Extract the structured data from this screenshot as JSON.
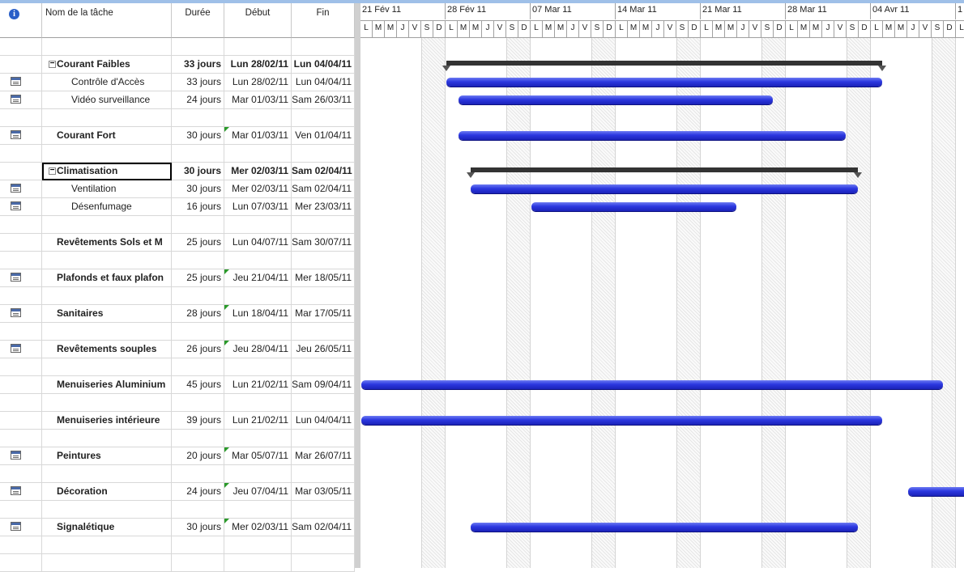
{
  "headers": {
    "name": "Nom de la tâche",
    "duree": "Durée",
    "debut": "Début",
    "fin": "Fin"
  },
  "timescale": {
    "weeks": [
      "21 Fév 11",
      "28 Fév 11",
      "07 Mar 11",
      "14 Mar 11",
      "21 Mar 11",
      "28 Mar 11",
      "04 Avr 11",
      "1"
    ],
    "days": [
      "L",
      "M",
      "M",
      "J",
      "V",
      "S",
      "D"
    ]
  },
  "rows": [
    {
      "name": "",
      "dur": "",
      "deb": "",
      "fin": ""
    },
    {
      "name": "Courant Faibles",
      "dur": "33 jours",
      "deb": "Lun 28/02/11",
      "fin": "Lun 04/04/11",
      "bold": true,
      "summary": true
    },
    {
      "name": "Contrôle d'Accès",
      "dur": "33 jours",
      "deb": "Lun 28/02/11",
      "fin": "Lun 04/04/11",
      "note": true,
      "child": true
    },
    {
      "name": "Vidéo surveillance",
      "dur": "24 jours",
      "deb": "Mar 01/03/11",
      "fin": "Sam 26/03/11",
      "note": true,
      "child": true
    },
    {
      "name": "",
      "dur": "",
      "deb": "",
      "fin": ""
    },
    {
      "name": "Courant Fort",
      "dur": "30 jours",
      "deb": "Mar 01/03/11",
      "fin": "Ven 01/04/11",
      "bold": true,
      "note": true,
      "flag": true
    },
    {
      "name": "",
      "dur": "",
      "deb": "",
      "fin": ""
    },
    {
      "name": "Climatisation",
      "dur": "30 jours",
      "deb": "Mer 02/03/11",
      "fin": "Sam 02/04/11",
      "bold": true,
      "summary": true,
      "selected": true
    },
    {
      "name": "Ventilation",
      "dur": "30 jours",
      "deb": "Mer 02/03/11",
      "fin": "Sam 02/04/11",
      "note": true,
      "child": true
    },
    {
      "name": "Désenfumage",
      "dur": "16 jours",
      "deb": "Lun 07/03/11",
      "fin": "Mer 23/03/11",
      "note": true,
      "child": true
    },
    {
      "name": "",
      "dur": "",
      "deb": "",
      "fin": ""
    },
    {
      "name": "Revêtements Sols et M",
      "dur": "25 jours",
      "deb": "Lun 04/07/11",
      "fin": "Sam 30/07/11",
      "bold": true
    },
    {
      "name": "",
      "dur": "",
      "deb": "",
      "fin": ""
    },
    {
      "name": "Plafonds et faux plafon",
      "dur": "25 jours",
      "deb": "Jeu 21/04/11",
      "fin": "Mer 18/05/11",
      "bold": true,
      "note": true,
      "flag": true
    },
    {
      "name": "",
      "dur": "",
      "deb": "",
      "fin": ""
    },
    {
      "name": "Sanitaires",
      "dur": "28 jours",
      "deb": "Lun 18/04/11",
      "fin": "Mar 17/05/11",
      "bold": true,
      "note": true,
      "flag": true
    },
    {
      "name": "",
      "dur": "",
      "deb": "",
      "fin": ""
    },
    {
      "name": "Revêtements souples",
      "dur": "26 jours",
      "deb": "Jeu 28/04/11",
      "fin": "Jeu 26/05/11",
      "bold": true,
      "note": true,
      "flag": true
    },
    {
      "name": "",
      "dur": "",
      "deb": "",
      "fin": ""
    },
    {
      "name": "Menuiseries Aluminium",
      "dur": "45 jours",
      "deb": "Lun 21/02/11",
      "fin": "Sam 09/04/11",
      "bold": true
    },
    {
      "name": "",
      "dur": "",
      "deb": "",
      "fin": ""
    },
    {
      "name": "Menuiseries intérieure",
      "dur": "39 jours",
      "deb": "Lun 21/02/11",
      "fin": "Lun 04/04/11",
      "bold": true
    },
    {
      "name": "",
      "dur": "",
      "deb": "",
      "fin": ""
    },
    {
      "name": "Peintures",
      "dur": "20 jours",
      "deb": "Mar 05/07/11",
      "fin": "Mar 26/07/11",
      "bold": true,
      "note": true,
      "flag": true
    },
    {
      "name": "",
      "dur": "",
      "deb": "",
      "fin": ""
    },
    {
      "name": "Décoration",
      "dur": "24 jours",
      "deb": "Jeu 07/04/11",
      "fin": "Mar 03/05/11",
      "bold": true,
      "note": true,
      "flag": true
    },
    {
      "name": "",
      "dur": "",
      "deb": "",
      "fin": ""
    },
    {
      "name": "Signalétique",
      "dur": "30 jours",
      "deb": "Mer 02/03/11",
      "fin": "Sam 02/04/11",
      "bold": true,
      "note": true,
      "flag": true
    },
    {
      "name": "",
      "dur": "",
      "deb": "",
      "fin": ""
    },
    {
      "name": "",
      "dur": "",
      "deb": "",
      "fin": ""
    }
  ],
  "colors": {
    "bar": "#2c38e0",
    "summary_bar": "#333333",
    "flag": "#2a9a2a",
    "header_accent": "#9fc0e8"
  }
}
